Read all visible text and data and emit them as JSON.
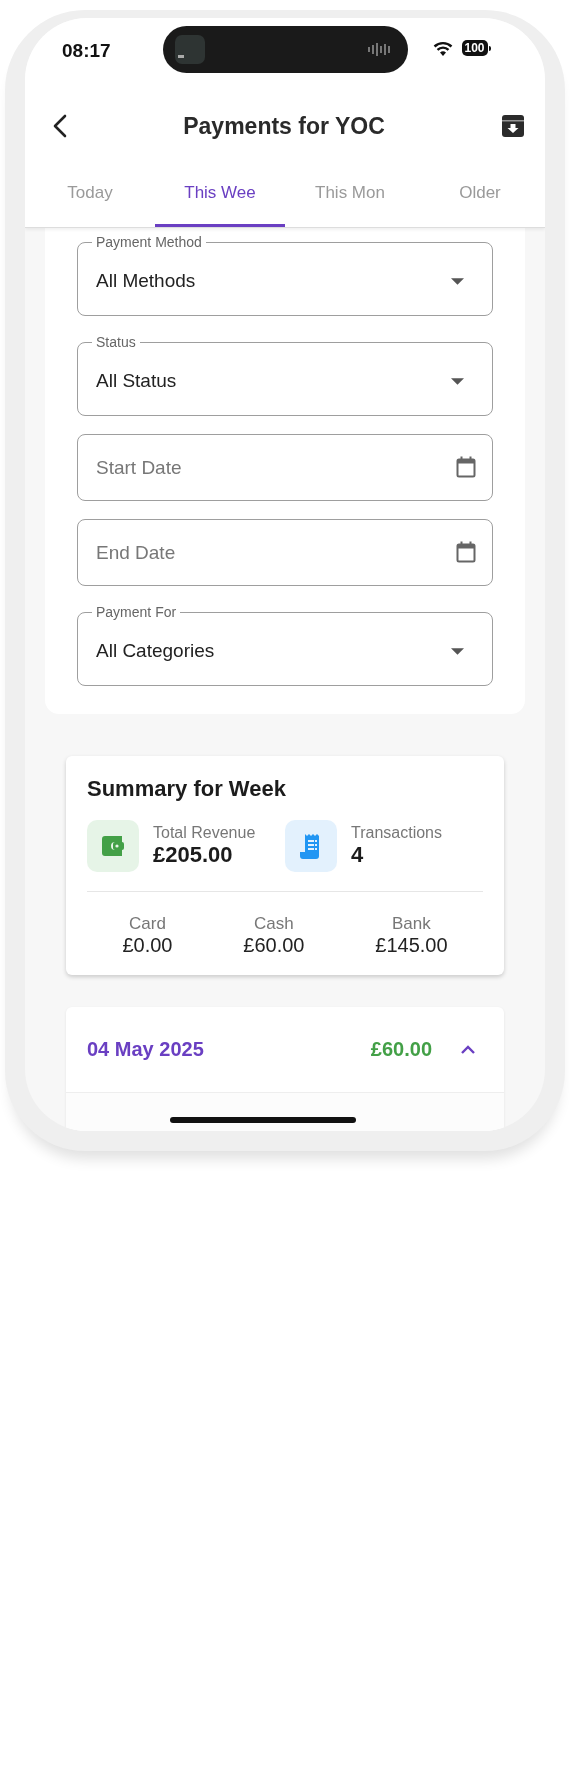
{
  "status_bar": {
    "time": "08:17",
    "battery": "100"
  },
  "header": {
    "title": "Payments for YOC"
  },
  "tabs": [
    {
      "label": "Today",
      "selected": false
    },
    {
      "label": "This Wee",
      "selected": true
    },
    {
      "label": "This Mon",
      "selected": false
    },
    {
      "label": "Older",
      "selected": false
    }
  ],
  "filters": [
    {
      "kind": "dropdown",
      "label": "Payment Method",
      "value": "All Methods"
    },
    {
      "kind": "dropdown",
      "label": "Status",
      "value": "All Status"
    },
    {
      "kind": "date",
      "placeholder": "Start Date"
    },
    {
      "kind": "date",
      "placeholder": "End Date"
    },
    {
      "kind": "dropdown",
      "label": "Payment For",
      "value": "All Categories"
    }
  ],
  "summary": {
    "title": "Summary for Week",
    "stats": [
      {
        "kind": "revenue",
        "label": "Total Revenue",
        "value": "£205.00"
      },
      {
        "kind": "transactions",
        "label": "Transactions",
        "value": "4"
      }
    ],
    "methods": [
      {
        "label": "Card",
        "value": "£0.00"
      },
      {
        "label": "Cash",
        "value": "£60.00"
      },
      {
        "label": "Bank",
        "value": "£145.00"
      }
    ]
  },
  "days": [
    {
      "date": "04 May 2025",
      "total": "£60.00",
      "expanded": true
    }
  ]
}
